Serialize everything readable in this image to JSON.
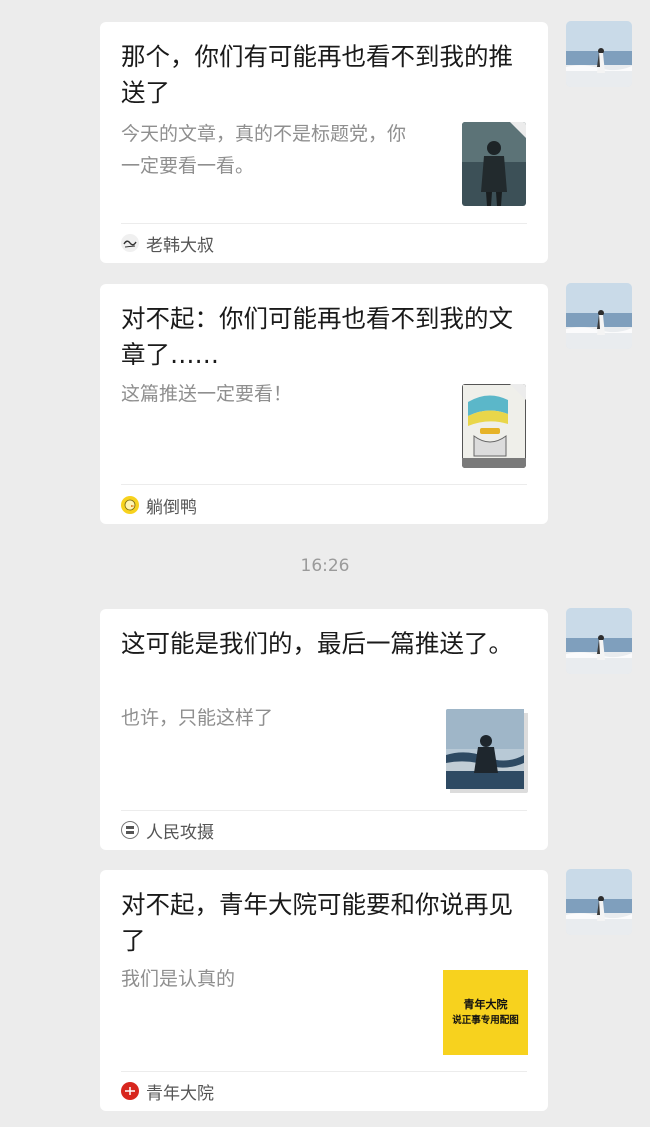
{
  "messages": [
    {
      "title": "那个，你们有可能再也看不到我的推送了",
      "desc": "今天的文章，真的不是标题党，你一定要看一看。",
      "source": "老韩大叔",
      "source_icon": "old-han-logo-icon",
      "thumbnail": "person-standing-photo"
    },
    {
      "title": "对不起：你们可能再也看不到我的文章了……",
      "desc": "这篇推送一定要看！",
      "source": "躺倒鸭",
      "source_icon": "duck-logo-icon",
      "thumbnail": "cartoon-illustration"
    },
    {
      "title": "这可能是我们的，最后一篇推送了。",
      "desc": "也许，只能这样了",
      "source": "人民攻摄",
      "source_icon": "people-photo-logo-icon",
      "thumbnail": "silhouette-at-sea-photo"
    },
    {
      "title": "对不起，青年大院可能要和你说再见了",
      "desc": "我们是认真的",
      "source": "青年大院",
      "source_icon": "youth-courtyard-logo-icon",
      "thumbnail": "yellow-text-card",
      "thumb_text": [
        "青年大院",
        "说正事专用配图"
      ]
    }
  ],
  "timestamp": "16:26",
  "colors": {
    "background": "#ececec",
    "card": "#ffffff",
    "title": "#1a1a1a",
    "desc": "#8f8f8f",
    "thumb_yellow": "#f7d21e",
    "source_red": "#d7261e"
  }
}
